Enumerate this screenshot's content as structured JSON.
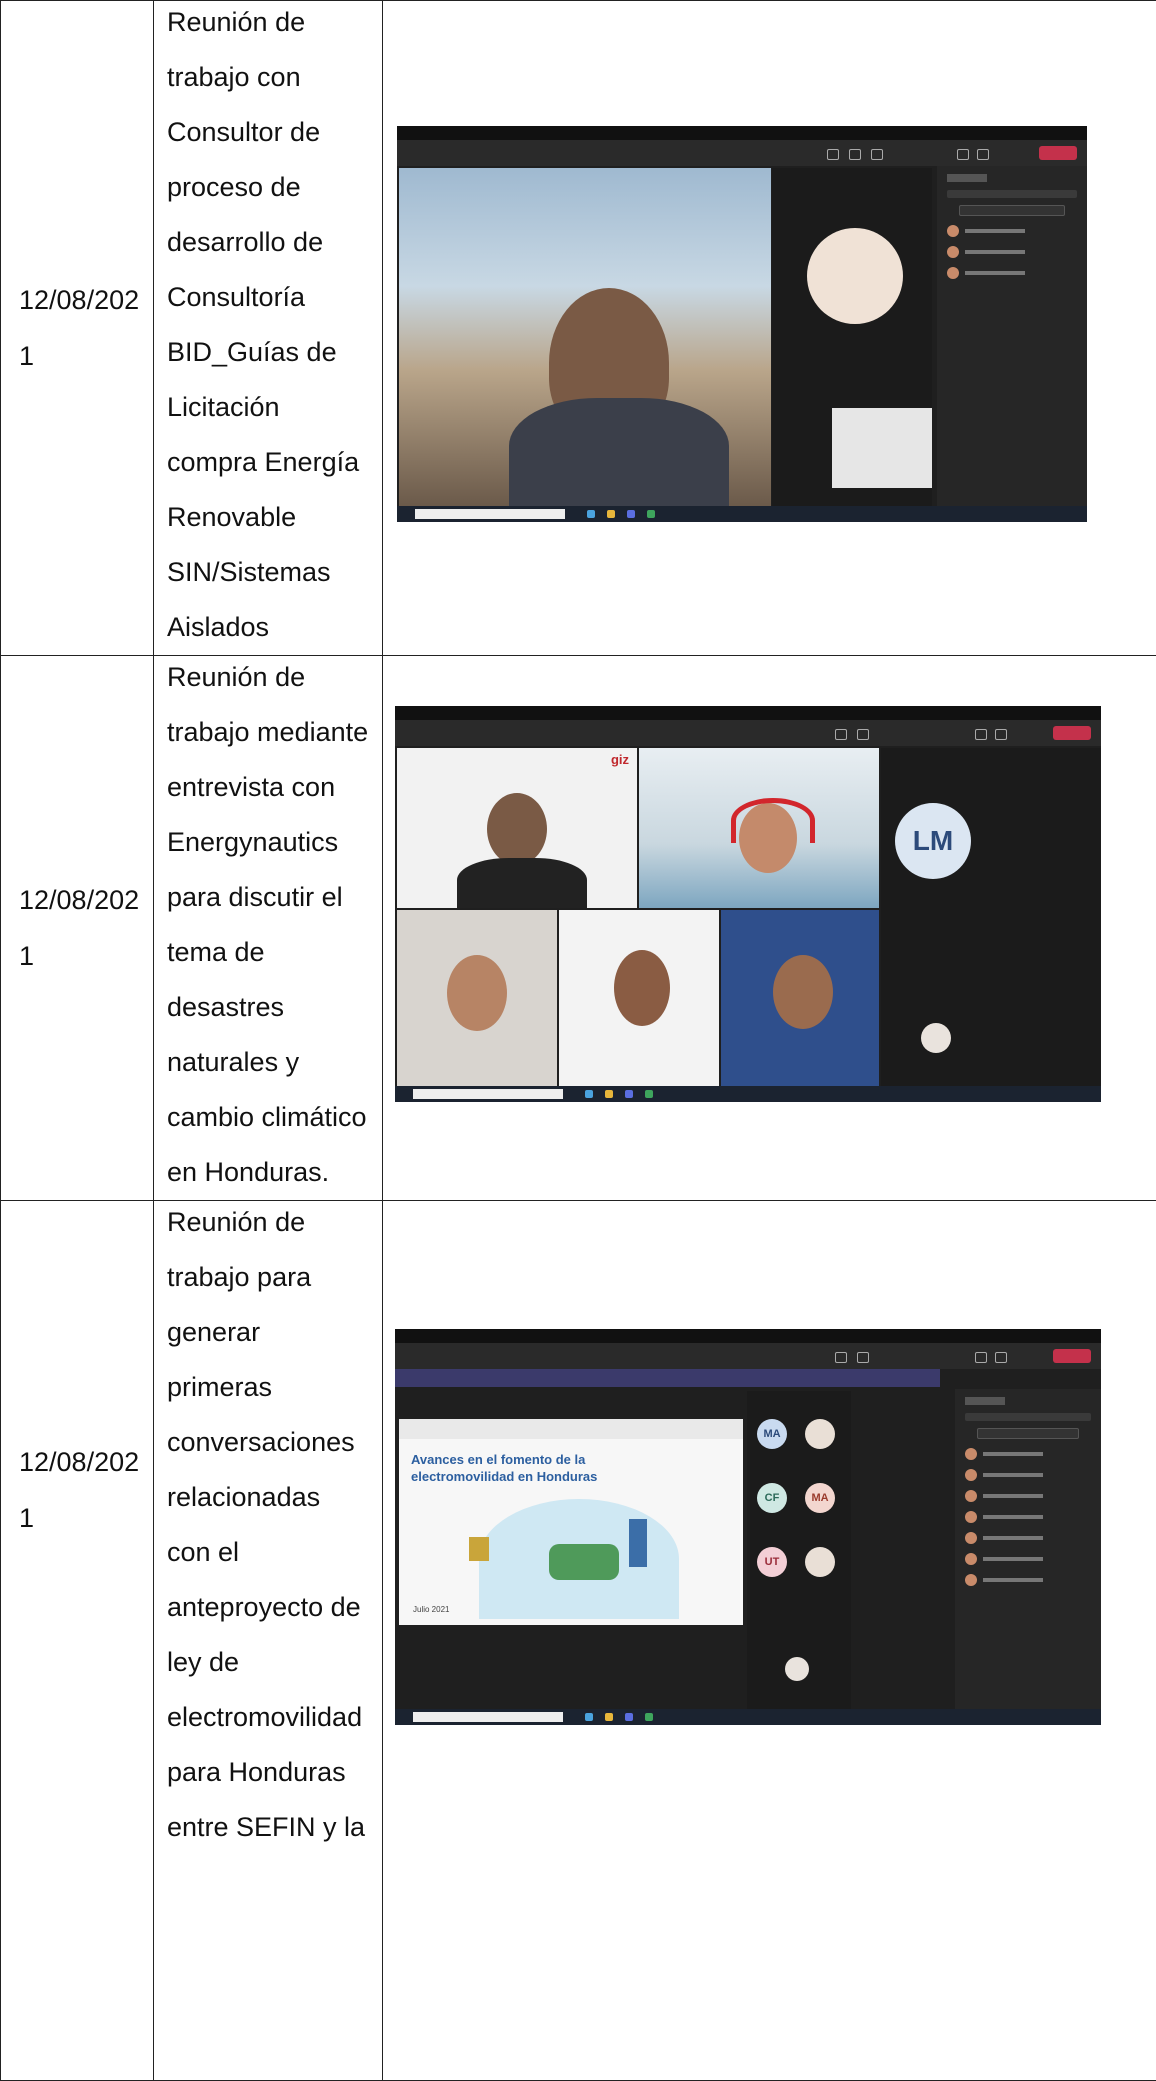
{
  "rows": [
    {
      "date": "12/08/202\n1",
      "description_lines": [
        "Reunión de",
        "trabajo con",
        "Consultor de",
        "proceso de",
        "desarrollo de",
        "Consultoría",
        "BID_Guías de",
        "Licitación",
        "compra Energía",
        "Renovable",
        "SIN/Sistemas",
        "Aislados"
      ],
      "image": "teams-meeting-screenshot-1"
    },
    {
      "date": "12/08/202\n1",
      "description_lines": [
        "Reunión de",
        "trabajo mediante",
        "entrevista con",
        "Energynautics",
        "para discutir el",
        "tema de",
        "desastres",
        "naturales y",
        "cambio climático",
        "en Honduras."
      ],
      "image": "teams-meeting-screenshot-2",
      "avatar_initials": "LM",
      "logo_text": "giz"
    },
    {
      "date": "12/08/202\n1",
      "description_lines": [
        "Reunión de",
        "trabajo para",
        "generar",
        "primeras",
        "conversaciones",
        "relacionadas",
        "con el",
        "anteproyecto de",
        "ley de",
        "electromovilidad",
        "para Honduras",
        "entre SEFIN y la"
      ],
      "image": "teams-meeting-screenshot-3",
      "slide_title_lines": [
        "Avances en el fomento de la",
        "electromovilidad en Honduras"
      ],
      "slide_date": "Julio 2021",
      "participant_initials": [
        "MA",
        "CF",
        "MA",
        "UT"
      ]
    }
  ]
}
